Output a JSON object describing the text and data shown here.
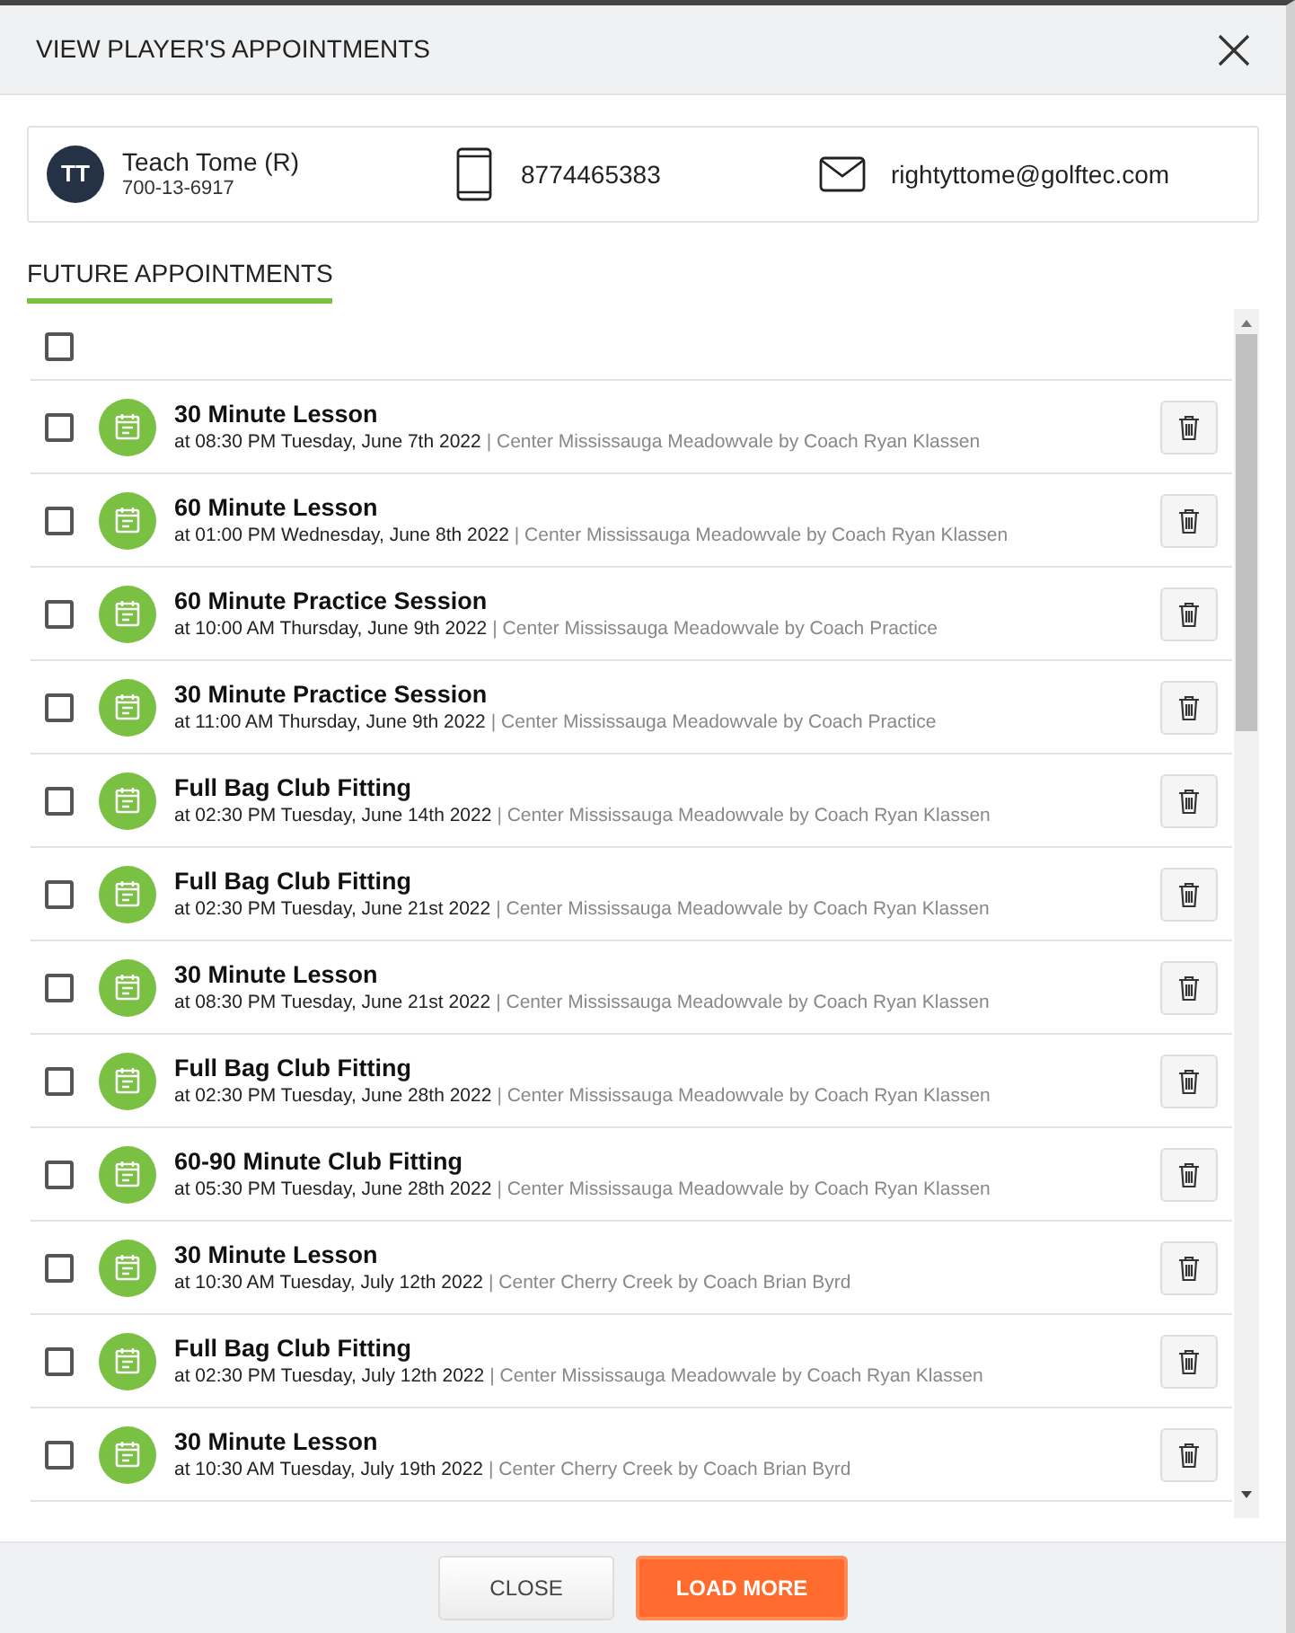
{
  "dialog": {
    "title": "VIEW PLAYER'S APPOINTMENTS"
  },
  "player": {
    "initials": "TT",
    "name": "Teach Tome (R)",
    "id": "700-13-6917",
    "phone": "8774465383",
    "email": "rightyttome@golftec.com"
  },
  "tabs": [
    {
      "label": "FUTURE APPOINTMENTS",
      "selected": true
    }
  ],
  "select_all": {
    "checked": false
  },
  "appointments": [
    {
      "title": "30 Minute Lesson",
      "when": "at 08:30 PM Tuesday, June 7th 2022",
      "where": "| Center Mississauga Meadowvale by Coach Ryan Klassen",
      "checked": false
    },
    {
      "title": "60 Minute Lesson",
      "when": "at 01:00 PM Wednesday, June 8th 2022",
      "where": "| Center Mississauga Meadowvale by Coach Ryan Klassen",
      "checked": false
    },
    {
      "title": "60 Minute Practice Session",
      "when": "at 10:00 AM Thursday, June 9th 2022",
      "where": "| Center Mississauga Meadowvale by Coach Practice",
      "checked": false
    },
    {
      "title": "30 Minute Practice Session",
      "when": "at 11:00 AM Thursday, June 9th 2022",
      "where": "| Center Mississauga Meadowvale by Coach Practice",
      "checked": false
    },
    {
      "title": "Full Bag Club Fitting",
      "when": "at 02:30 PM Tuesday, June 14th 2022",
      "where": "| Center Mississauga Meadowvale by Coach Ryan Klassen",
      "checked": false
    },
    {
      "title": "Full Bag Club Fitting",
      "when": "at 02:30 PM Tuesday, June 21st 2022",
      "where": "| Center Mississauga Meadowvale by Coach Ryan Klassen",
      "checked": false
    },
    {
      "title": "30 Minute Lesson",
      "when": "at 08:30 PM Tuesday, June 21st 2022",
      "where": "| Center Mississauga Meadowvale by Coach Ryan Klassen",
      "checked": false
    },
    {
      "title": "Full Bag Club Fitting",
      "when": "at 02:30 PM Tuesday, June 28th 2022",
      "where": "| Center Mississauga Meadowvale by Coach Ryan Klassen",
      "checked": false
    },
    {
      "title": "60-90 Minute Club Fitting",
      "when": "at 05:30 PM Tuesday, June 28th 2022",
      "where": "| Center Mississauga Meadowvale by Coach Ryan Klassen",
      "checked": false
    },
    {
      "title": "30 Minute Lesson",
      "when": "at 10:30 AM Tuesday, July 12th 2022",
      "where": "| Center Cherry Creek by Coach Brian Byrd",
      "checked": false
    },
    {
      "title": "Full Bag Club Fitting",
      "when": "at 02:30 PM Tuesday, July 12th 2022",
      "where": "| Center Mississauga Meadowvale by Coach Ryan Klassen",
      "checked": false
    },
    {
      "title": "30 Minute Lesson",
      "when": "at 10:30 AM Tuesday, July 19th 2022",
      "where": "| Center Cherry Creek by Coach Brian Byrd",
      "checked": false
    }
  ],
  "buttons": [
    {
      "label": "CLOSE",
      "kind": "secondary"
    },
    {
      "label": "LOAD MORE",
      "kind": "primary"
    }
  ]
}
